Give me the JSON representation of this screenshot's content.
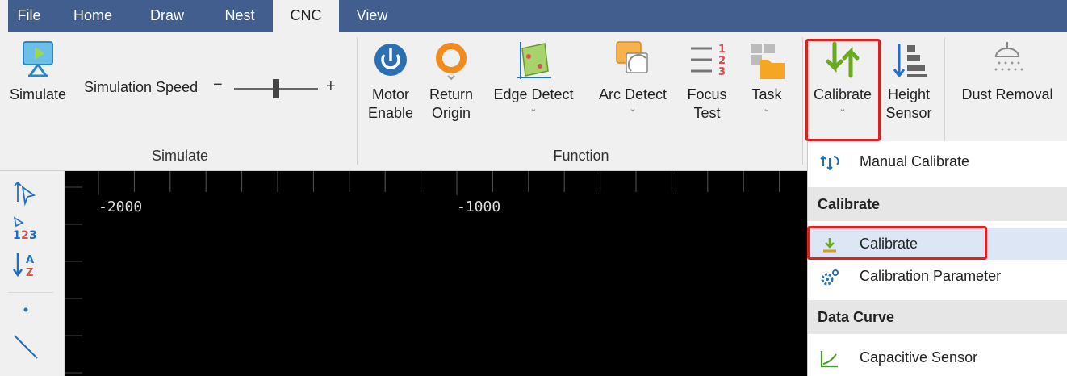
{
  "menu": {
    "tabs": [
      {
        "label": "File"
      },
      {
        "label": "Home"
      },
      {
        "label": "Draw"
      },
      {
        "label": "Nest"
      },
      {
        "label": "CNC"
      },
      {
        "label": "View"
      }
    ],
    "active_tab": "CNC"
  },
  "ribbon": {
    "simulate_group": {
      "simulate_label": "Simulate",
      "speed_label": "Simulation Speed",
      "minus": "−",
      "plus": "+",
      "speed_level": 0.5,
      "group_label": "Simulate"
    },
    "function_group": {
      "group_label": "Function",
      "buttons": [
        {
          "label": "Motor\nEnable",
          "icon": "power-icon"
        },
        {
          "label": "Return\nOrigin",
          "icon": "origin-ring-icon"
        },
        {
          "label": "Edge Detect",
          "icon": "edge-detect-icon"
        },
        {
          "label": "Arc Detect",
          "icon": "arc-detect-icon"
        },
        {
          "label": "Focus\nTest",
          "icon": "focus-test-icon"
        },
        {
          "label": "Task",
          "icon": "task-folder-icon"
        }
      ]
    },
    "cnc_group": {
      "calibrate_label": "Calibrate",
      "height_sensor_label": "Height\nSensor",
      "dust_removal_label": "Dust Removal"
    }
  },
  "canvas": {
    "ruler_labels": [
      "-2000",
      "-1000"
    ]
  },
  "dropdown": {
    "manual_calibrate": "Manual Calibrate",
    "section_calibrate": "Calibrate",
    "calibrate_item": "Calibrate",
    "calibration_parameter": "Calibration Parameter",
    "section_data_curve": "Data Curve",
    "capacitive_sensor": "Capacitive Sensor"
  },
  "colors": {
    "menu_bar": "#425e8e",
    "highlight": "#e02020",
    "accent_green": "#6aaa1e",
    "accent_blue": "#1f6fc4"
  }
}
